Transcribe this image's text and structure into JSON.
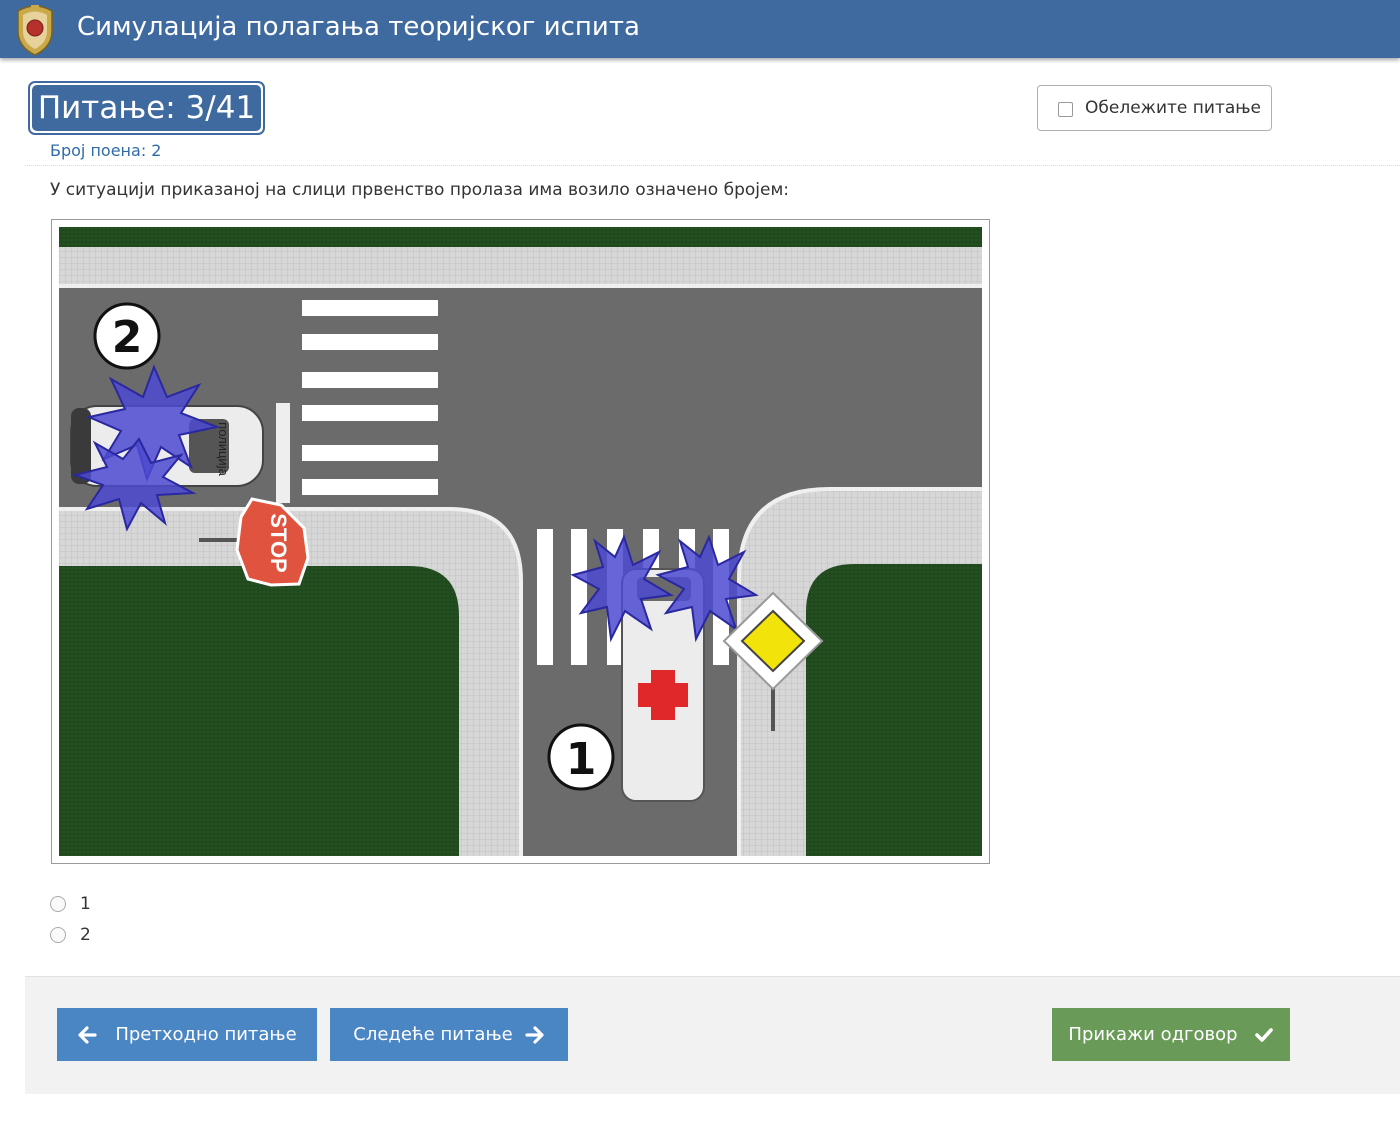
{
  "header": {
    "title": "Симулација полагања теоријског испита",
    "logo": "police-crest-icon"
  },
  "question": {
    "number_label": "Питање: 3/41",
    "points_label": "Број поена: 2",
    "flag_label": "Обележите питање",
    "flag_checked": false,
    "text": "У ситуацији приказаној на слици првенство пролаза има возило означено бројем:"
  },
  "illustration": {
    "vehicle_1_number": "1",
    "vehicle_2_number": "2",
    "stop_sign_text": "STOP",
    "police_car_text": "полиција"
  },
  "answers": [
    {
      "label": "1",
      "selected": false
    },
    {
      "label": "2",
      "selected": false
    }
  ],
  "footer": {
    "prev_label": "Претходно питање",
    "next_label": "Следеће питање",
    "show_answer_label": "Прикажи одговор"
  },
  "colors": {
    "primary": "#3f6aa0",
    "button_blue": "#4a85c4",
    "button_green": "#6a9a58"
  }
}
